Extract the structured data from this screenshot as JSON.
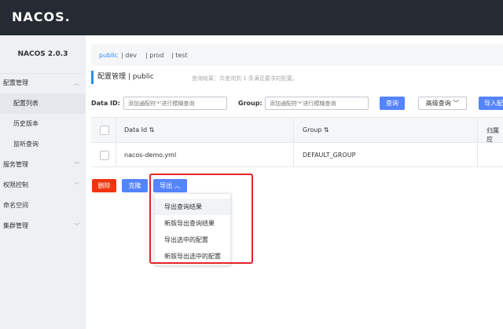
{
  "app": {
    "logo": "NACOS."
  },
  "sidebar": {
    "version": "NACOS 2.0.3",
    "items": [
      {
        "label": "配置管理",
        "expanded": true
      },
      {
        "label": "配置列表",
        "sub": true,
        "active": true
      },
      {
        "label": "历史版本",
        "sub": true
      },
      {
        "label": "监听查询",
        "sub": true
      },
      {
        "label": "服务管理"
      },
      {
        "label": "权限控制"
      },
      {
        "label": "命名空间"
      },
      {
        "label": "集群管理"
      }
    ]
  },
  "namespaces": [
    {
      "label": "public",
      "active": true
    },
    {
      "label": "| dev"
    },
    {
      "label": "| prod"
    },
    {
      "label": "| test"
    }
  ],
  "page": {
    "title": "配置管理 | public",
    "query_hint": "查询结果：共查询到 1 条满足要求的配置。"
  },
  "search": {
    "dataid_label": "Data ID:",
    "dataid_placeholder": "添加通配符'*'进行模糊查询",
    "group_label": "Group:",
    "group_placeholder": "添加通配符'*'进行模糊查询",
    "query_button": "查询",
    "advanced_button": "高级查询",
    "import_button": "导入配"
  },
  "table": {
    "headers": [
      "Data Id",
      "Group",
      "归属应"
    ],
    "rows": [
      {
        "data_id": "nacos-demo.yml",
        "group": "DEFAULT_GROUP"
      }
    ]
  },
  "actions": {
    "delete": "删除",
    "clone": "克隆",
    "export": "导出"
  },
  "export_menu": [
    "导出查询结果",
    "新版导出查询结果",
    "导出选中的配置",
    "新版导出选中的配置"
  ],
  "colors": {
    "topbar": "#262b33",
    "primary": "#5584ff",
    "danger": "#f0350e",
    "highlight": "#e3242b",
    "link": "#2d8cf0"
  }
}
